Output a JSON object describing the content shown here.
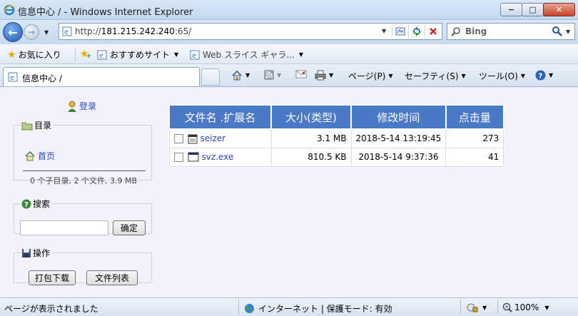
{
  "window": {
    "title": "信息中心 / - Windows Internet Explorer",
    "minimize": "−",
    "maximize": "□",
    "close": "✕"
  },
  "address": {
    "url_prefix": "http://",
    "url_host": "181.215.242.240",
    "url_suffix": ":65/"
  },
  "search": {
    "engine": "Bing"
  },
  "favorites": {
    "favorites_label": "お気に入り",
    "suggested_sites": "おすすめサイト",
    "web_slice": "Web スライス ギャラ..."
  },
  "tab": {
    "title": "信息中心 /"
  },
  "commandbar": {
    "page": "ページ(P)",
    "safety": "セーフティ(S)",
    "tools": "ツール(O)"
  },
  "sidebar": {
    "login": "登录",
    "dir_legend": "目录",
    "home": "首页",
    "summary": "0 个子目录, 2 个文件, 3.9 MB",
    "search_legend": "搜索",
    "search_value": "",
    "search_button": "确定",
    "ops_legend": "操作",
    "download_button": "打包下载",
    "list_button": "文件列表"
  },
  "files": {
    "headers": [
      "文件名 .扩展名",
      "大小(类型)",
      "修改时间",
      "点击量"
    ],
    "rows": [
      {
        "name": "seizer",
        "size": "3.1 MB",
        "modified": "2018-5-14 13:19:45",
        "hits": "273"
      },
      {
        "name": "svz.exe",
        "size": "810.5 KB",
        "modified": "2018-5-14 9:37:36",
        "hits": "41"
      }
    ]
  },
  "status": {
    "message": "ページが表示されました",
    "zone": "インターネット | 保護モード: 有効",
    "zoom": "100%"
  },
  "colors": {
    "table_header": "#4a79c7",
    "link": "#2b46b8",
    "page_bg": "#f3f2fb"
  }
}
